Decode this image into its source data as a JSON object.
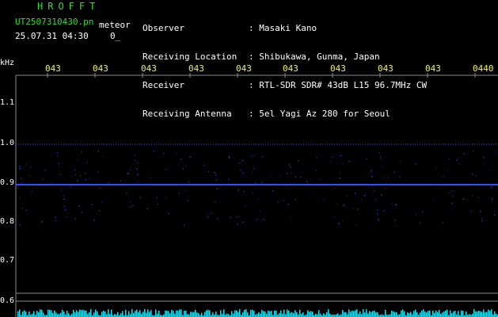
{
  "header": {
    "app_name": "HROFFT",
    "file_name": "UT2507310430.pn",
    "meteor_label": "meteor",
    "timestamp": "25.07.31 04:30",
    "count": "0_"
  },
  "station_info": [
    {
      "key": "Observer",
      "sep": ":",
      "value": "Masaki Kano"
    },
    {
      "key": "Receiving Location",
      "sep": ":",
      "value": "Shibukawa, Gunma, Japan"
    },
    {
      "key": "Receiver",
      "sep": ":",
      "value": "RTL-SDR SDR# 43dB L15 96.7MHz CW"
    },
    {
      "key": "Receiving Antenna",
      "sep": ":",
      "value": "5el Yagi Az 280 for Seoul"
    }
  ],
  "axis": {
    "y_unit": "kHz",
    "y_ticks": [
      "1.1",
      "1.0",
      "0.9",
      "0.8",
      "0.7",
      "0.6"
    ],
    "x_ticks": [
      "043",
      "043",
      "043",
      "043",
      "043",
      "043",
      "043",
      "043",
      "043",
      "0440"
    ]
  },
  "colors": {
    "background": "#000000",
    "grid": "#8a8a8a",
    "signal": "#3050ff",
    "spectrum": "#22ddee",
    "header_green": "#33dd33",
    "tick_yellow": "#f0f060"
  }
}
